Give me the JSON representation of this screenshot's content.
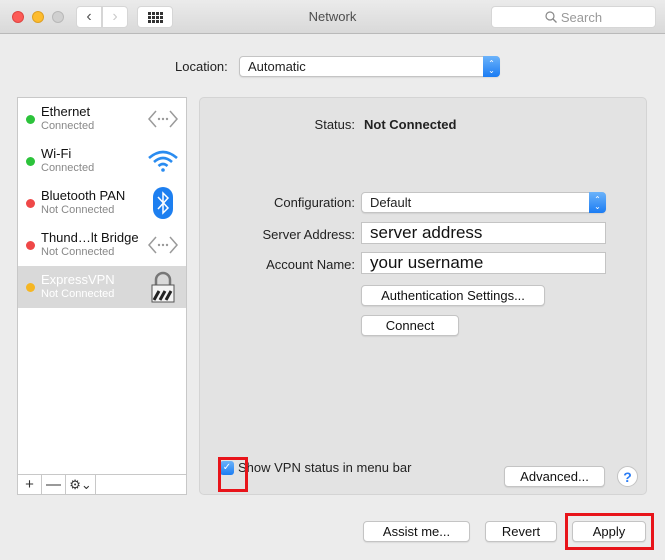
{
  "window": {
    "title": "Network",
    "search_placeholder": "Search",
    "back_glyph": "‹",
    "forward_glyph": "›"
  },
  "location": {
    "label": "Location:",
    "value": "Automatic"
  },
  "services": [
    {
      "name": "Ethernet",
      "state": "Connected",
      "dot_color": "#2cc33b",
      "icon": "ethernet-icon",
      "selected": false
    },
    {
      "name": "Wi-Fi",
      "state": "Connected",
      "dot_color": "#2cc33b",
      "icon": "wifi-icon",
      "selected": false
    },
    {
      "name": "Bluetooth PAN",
      "state": "Not Connected",
      "dot_color": "#ef4848",
      "icon": "bluetooth-icon",
      "selected": false
    },
    {
      "name": "Thund…lt Bridge",
      "state": "Not Connected",
      "dot_color": "#ef4848",
      "icon": "ethernet-icon",
      "selected": false
    },
    {
      "name": "ExpressVPN",
      "state": "Not Connected",
      "dot_color": "#f5b623",
      "icon": "vpn-lock-icon",
      "selected": true
    }
  ],
  "sidebar_toolbar": {
    "add": "+",
    "remove": "—",
    "gear": "⚙⌄"
  },
  "detail": {
    "status_label": "Status:",
    "status_value": "Not Connected",
    "configuration_label": "Configuration:",
    "configuration_value": "Default",
    "server_label": "Server Address:",
    "server_value": "server address",
    "account_label": "Account Name:",
    "account_value": "your username",
    "auth_button": "Authentication Settings...",
    "connect_button": "Connect",
    "show_vpn_label": "Show VPN status in menu bar",
    "show_vpn_checked": true,
    "advanced_button": "Advanced...",
    "help": "?"
  },
  "footer": {
    "assist": "Assist me...",
    "revert": "Revert",
    "apply": "Apply"
  },
  "colors": {
    "accent": "#1b7cf3",
    "highlight": "#e8141a"
  }
}
